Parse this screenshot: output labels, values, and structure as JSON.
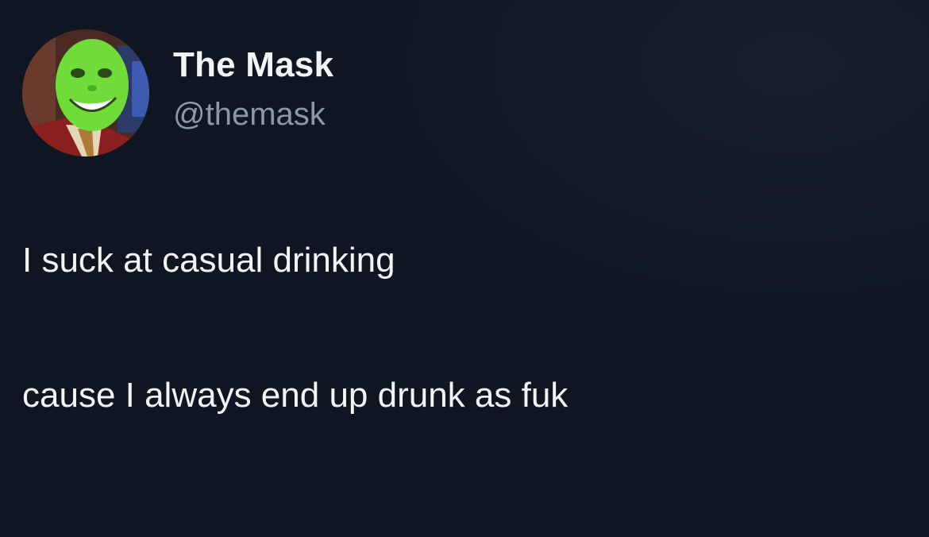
{
  "tweet": {
    "author": {
      "display_name": "The Mask",
      "handle": "@themask",
      "avatar_icon": "green-mask-face-avatar"
    },
    "text_lines": [
      "I suck at casual drinking",
      "cause I always end up drunk as fuk"
    ]
  },
  "colors": {
    "background": "#0f1621",
    "display_name": "#f3f4f6",
    "handle": "#8b98a5",
    "body_text": "#f2f3f5",
    "mask_green": "#6fdc3a"
  }
}
